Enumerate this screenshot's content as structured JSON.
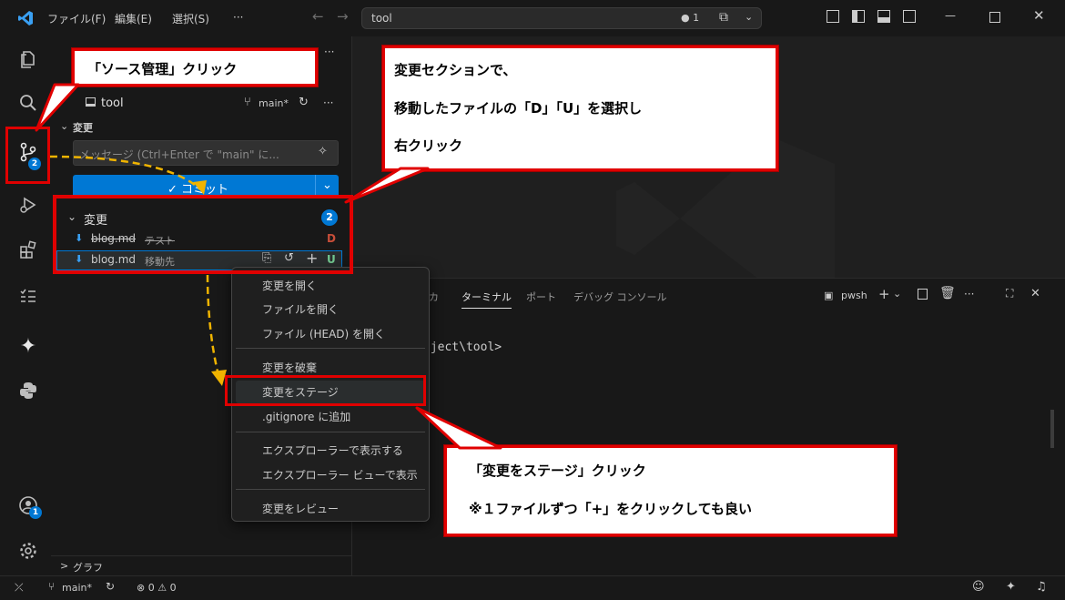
{
  "titlebar": {
    "menus": [
      "ファイル(F)",
      "編集(E)",
      "選択(S)",
      "···"
    ],
    "search_text": "tool",
    "badge": "● 1"
  },
  "sidebar": {
    "more": "···",
    "repo_name": "tool",
    "branch": "main*",
    "changes_header": "変更",
    "message_placeholder": "メッセージ (Ctrl+Enter で \"main\" に...",
    "commit_label": "✓ コミット",
    "changes_section": "変更",
    "changes_count": "2",
    "files": [
      {
        "name": "blog.md",
        "desc": "テスト",
        "status": "D"
      },
      {
        "name": "blog.md",
        "desc": "移動先",
        "status": "U"
      }
    ],
    "graph_label": "グラフ"
  },
  "panel": {
    "tabs": [
      "カ",
      "ターミナル",
      "ポート",
      "デバッグ コンソール"
    ],
    "terminal_type": "pwsh",
    "terminal_line": "oject\\tool>"
  },
  "context_menu": {
    "items": [
      "変更を開く",
      "ファイルを開く",
      "ファイル (HEAD) を開く",
      "変更を破棄",
      "変更をステージ",
      ".gitignore に追加",
      "エクスプローラーで表示する",
      "エクスプローラー ビューで表示",
      "変更をレビュー"
    ]
  },
  "callouts": {
    "source_control": "「ソース管理」クリック",
    "changes_line1": "変更セクションで、",
    "changes_line2": "移動したファイルの「D」「U」を選択し",
    "changes_line3": "右クリック",
    "stage_line1": "「変更をステージ」クリック",
    "stage_line2": "※１ファイルずつ「+」をクリックしても良い"
  },
  "activity": {
    "scm_badge": "2",
    "account_badge": "1"
  },
  "statusbar": {
    "branch": "main*",
    "problems": "⊗ 0 ⚠ 0"
  },
  "colors": {
    "accent_red": "#e00000",
    "badge_blue": "#0078d4",
    "deleted": "#c74e39",
    "untracked": "#73c991",
    "arrow_yellow": "#f0b400"
  }
}
